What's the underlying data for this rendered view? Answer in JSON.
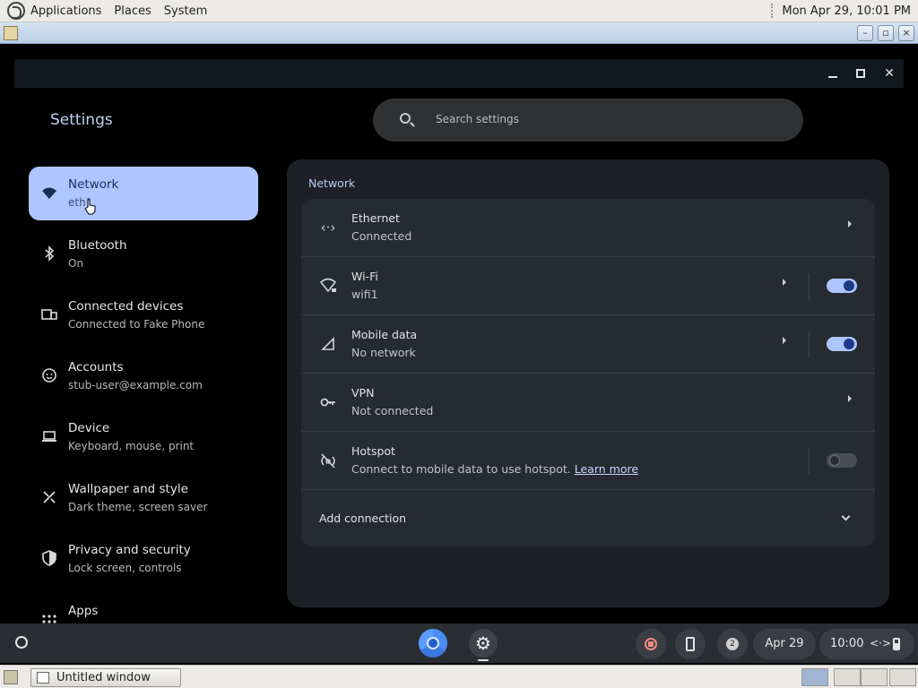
{
  "top_panel": {
    "menus": [
      "Applications",
      "Places",
      "System"
    ],
    "clock": "Mon Apr 29, 10:01 PM"
  },
  "settings": {
    "title": "Settings",
    "search_placeholder": "Search settings"
  },
  "sidebar": {
    "items": [
      {
        "label": "Network",
        "sub": "eth1",
        "icon": "wifi-icon",
        "active": true
      },
      {
        "label": "Bluetooth",
        "sub": "On",
        "icon": "bluetooth-icon"
      },
      {
        "label": "Connected devices",
        "sub": "Connected to Fake Phone",
        "icon": "phone-link-icon"
      },
      {
        "label": "Accounts",
        "sub": "stub-user@example.com",
        "icon": "account-icon"
      },
      {
        "label": "Device",
        "sub": "Keyboard, mouse, print",
        "icon": "laptop-icon"
      },
      {
        "label": "Wallpaper and style",
        "sub": "Dark theme, screen saver",
        "icon": "paintbrush-icon"
      },
      {
        "label": "Privacy and security",
        "sub": "Lock screen, controls",
        "icon": "shield-icon"
      },
      {
        "label": "Apps",
        "sub": "",
        "icon": "apps-grid-icon"
      }
    ]
  },
  "network": {
    "section_title": "Network",
    "rows": [
      {
        "title": "Ethernet",
        "sub": "Connected",
        "icon": "ethernet-icon"
      },
      {
        "title": "Wi-Fi",
        "sub": "wifi1",
        "icon": "wifi-lock-icon",
        "toggle": "on"
      },
      {
        "title": "Mobile data",
        "sub": "No network",
        "icon": "cell-signal-icon",
        "toggle": "on"
      },
      {
        "title": "VPN",
        "sub": "Not connected",
        "icon": "vpn-key-icon"
      },
      {
        "title": "Hotspot",
        "sub": "Connect to mobile data to use hotspot.",
        "link": "Learn more",
        "icon": "hotspot-icon",
        "toggle": "off"
      }
    ],
    "add_connection": "Add connection"
  },
  "shelf": {
    "notification_count": "2",
    "date": "Apr 29",
    "time": "10:00",
    "network_glyph": "<·>"
  },
  "taskbar": {
    "window_label": "Untitled window"
  },
  "colors": {
    "accent": "#aec6ff",
    "panel_bg": "#1d2026",
    "card_bg": "#262a31"
  }
}
